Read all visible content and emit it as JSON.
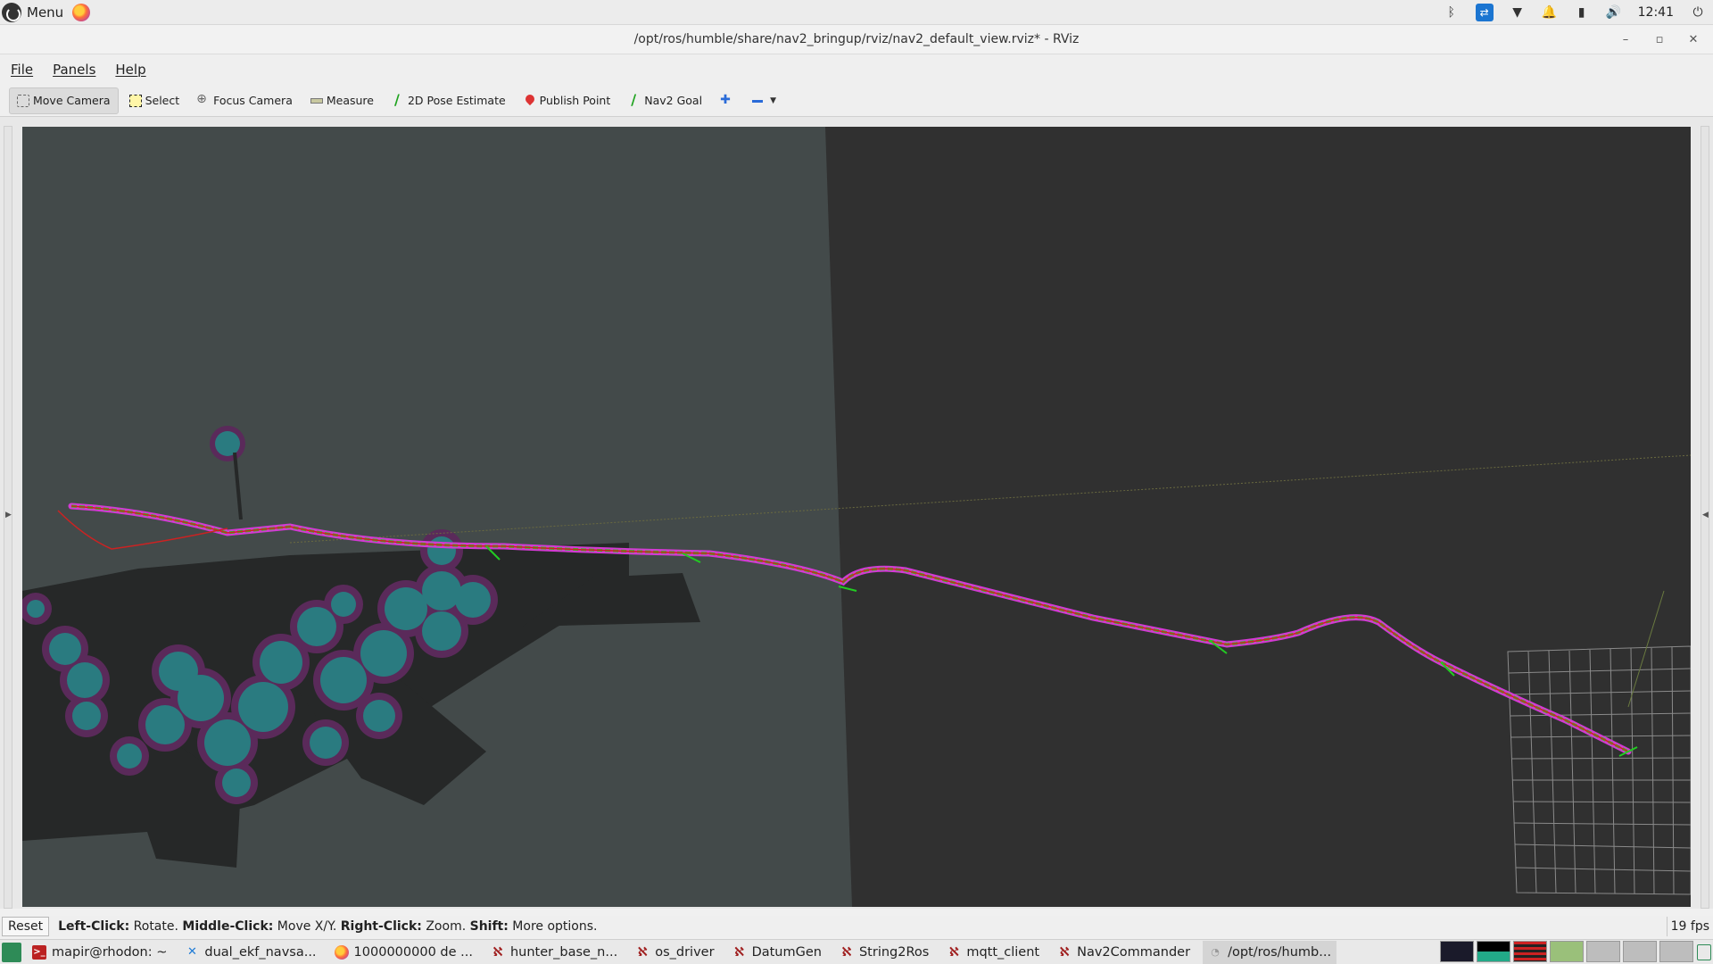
{
  "top_panel": {
    "menu_label": "Menu",
    "clock": "12:41"
  },
  "window": {
    "title": "/opt/ros/humble/share/nav2_bringup/rviz/nav2_default_view.rviz* - RViz"
  },
  "menubar": {
    "items": [
      "File",
      "Panels",
      "Help"
    ]
  },
  "toolbar": {
    "tools": [
      {
        "label": "Move Camera",
        "icon": "move-camera-icon"
      },
      {
        "label": "Select",
        "icon": "select-icon"
      },
      {
        "label": "Focus Camera",
        "icon": "focus-camera-icon"
      },
      {
        "label": "Measure",
        "icon": "measure-icon"
      },
      {
        "label": "2D Pose Estimate",
        "icon": "pose-estimate-icon"
      },
      {
        "label": "Publish Point",
        "icon": "publish-point-icon"
      },
      {
        "label": "Nav2 Goal",
        "icon": "nav2-goal-icon"
      }
    ],
    "active_tool": "Move Camera"
  },
  "statusbar": {
    "reset_label": "Reset",
    "hint_parts": [
      {
        "key": "Left-Click:",
        "text": " Rotate. "
      },
      {
        "key": "Middle-Click:",
        "text": " Move X/Y. "
      },
      {
        "key": "Right-Click:",
        "text": " Zoom. "
      },
      {
        "key": "Shift:",
        "text": " More options."
      }
    ],
    "fps": "19 fps"
  },
  "taskbar": {
    "items": [
      {
        "label": "mapir@rhodon: ~",
        "icon": "terminal-icon"
      },
      {
        "label": "dual_ekf_navsa...",
        "icon": "vscode-icon"
      },
      {
        "label": "1000000000 de ...",
        "icon": "firefox-icon"
      },
      {
        "label": "hunter_base_n...",
        "icon": "ros-icon"
      },
      {
        "label": "os_driver",
        "icon": "ros-icon"
      },
      {
        "label": "DatumGen",
        "icon": "ros-icon"
      },
      {
        "label": "String2Ros",
        "icon": "ros-icon"
      },
      {
        "label": "mqtt_client",
        "icon": "ros-icon"
      },
      {
        "label": "Nav2Commander",
        "icon": "ros-icon"
      },
      {
        "label": "/opt/ros/humb...",
        "icon": "rviz-icon"
      }
    ]
  },
  "colors": {
    "viewport_bg": "#303030",
    "map_light": "#434a4a",
    "costmap_teal": "#2a7b80",
    "costmap_purple": "#8a2a8a",
    "path_magenta": "#d33ad3",
    "path_green": "#22cc22",
    "path_red": "#cc2222"
  }
}
